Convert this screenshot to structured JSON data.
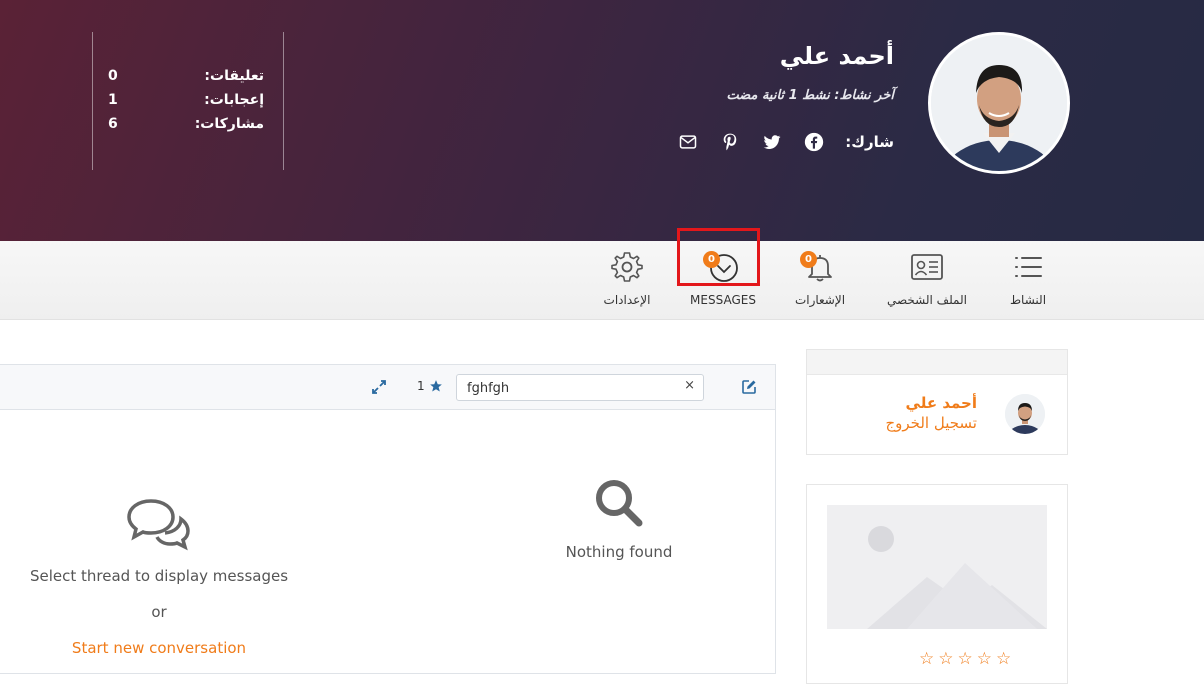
{
  "header": {
    "user_name": "أحمد علي",
    "last_active": "آخر نشاط: نشط 1 ثانية مضت",
    "share_label": "شارك:",
    "share_icons": [
      "facebook-icon",
      "twitter-icon",
      "pinterest-icon",
      "mail-icon"
    ],
    "stats": [
      {
        "label": "تعليقات:",
        "value": "0"
      },
      {
        "label": "إعجابات:",
        "value": "1"
      },
      {
        "label": "مشاركات:",
        "value": "6"
      }
    ]
  },
  "nav": {
    "items": [
      {
        "label": "النشاط",
        "icon": "list-icon"
      },
      {
        "label": "الملف الشخصي",
        "icon": "id-card-icon"
      },
      {
        "label": "الإشعارات",
        "icon": "bell-icon",
        "badge": "0"
      },
      {
        "label": "MESSAGES",
        "icon": "chevron-circle-icon",
        "badge": "0"
      },
      {
        "label": "الإعدادات",
        "icon": "gear-icon"
      }
    ]
  },
  "messages": {
    "search_value": "fghfgh",
    "clear_symbol": "×",
    "starred_count": "1",
    "nothing_found": "Nothing found",
    "select_thread": "Select thread to display messages",
    "or": "or",
    "start_new": "Start new conversation"
  },
  "sidebar": {
    "user_name": "أحمد علي",
    "logout": "تسجيل الخروج",
    "rating_stars": 5
  },
  "colors": {
    "accent": "#f07c1a",
    "highlight": "#e3171b"
  }
}
